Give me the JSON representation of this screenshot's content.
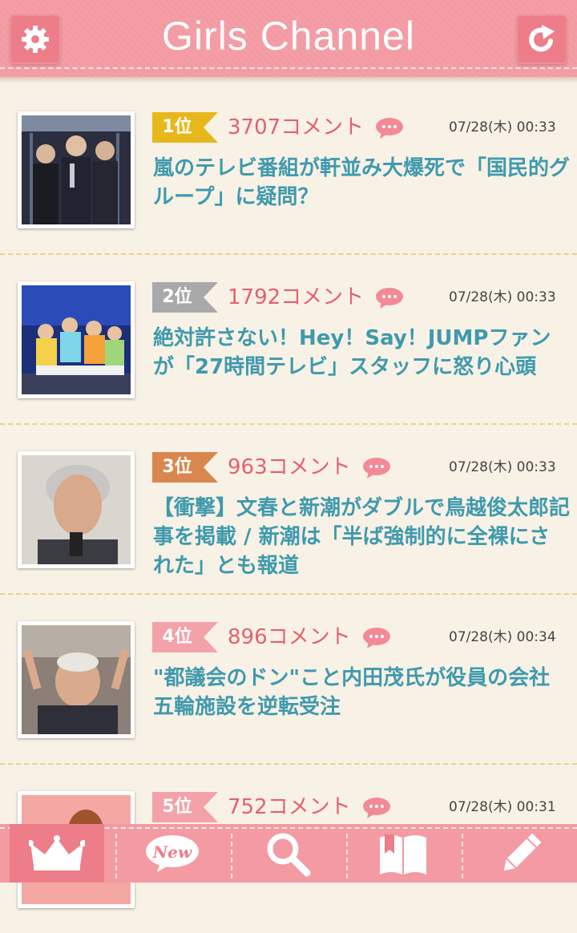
{
  "header": {
    "title": "Girls Channel",
    "settings_icon": "gear-icon",
    "refresh_icon": "refresh-icon"
  },
  "colors": {
    "header_pink": "#f39aa3",
    "button_pink": "#ec7d89",
    "title_teal": "#3f9aad",
    "comment_red": "#e5606e",
    "rank1_gold": "#e7b81b",
    "rank2_gray": "#a9a9a9",
    "rank3_orange": "#d9874f",
    "rank45_pink": "#f3a2a9"
  },
  "items": [
    {
      "rank": "1位",
      "comments": "3707コメント",
      "date": "07/28(木) 00:33",
      "title": "嵐のテレビ番組が軒並み大爆死で「国民的グループ」に疑問？",
      "thumb": "group-photo"
    },
    {
      "rank": "2位",
      "comments": "1792コメント",
      "date": "07/28(木) 00:33",
      "title": "絶対許さない！Hey！Say！JUMPファンが「27時間テレビ」スタッフに怒り心頭",
      "thumb": "stage-photo"
    },
    {
      "rank": "3位",
      "comments": "963コメント",
      "date": "07/28(木) 00:33",
      "title": "【衝撃】文春と新潮がダブルで鳥越俊太郎記事を掲載 / 新潮は「半ば強制的に全裸にされた」とも報道",
      "thumb": "portrait-photo"
    },
    {
      "rank": "4位",
      "comments": "896コメント",
      "date": "07/28(木) 00:34",
      "title": "\"都議会のドン\"こと内田茂氏が役員の会社　五輪施設を逆転受注",
      "thumb": "cheering-photo"
    },
    {
      "rank": "5位",
      "comments": "752コメント",
      "date": "07/28(木) 00:31",
      "title": "",
      "thumb": "woman-photo"
    }
  ],
  "nav": [
    {
      "icon": "crown-icon",
      "active": true
    },
    {
      "icon": "new-bubble-icon",
      "label": "New"
    },
    {
      "icon": "search-icon"
    },
    {
      "icon": "bookmark-book-icon"
    },
    {
      "icon": "pencil-icon"
    }
  ]
}
